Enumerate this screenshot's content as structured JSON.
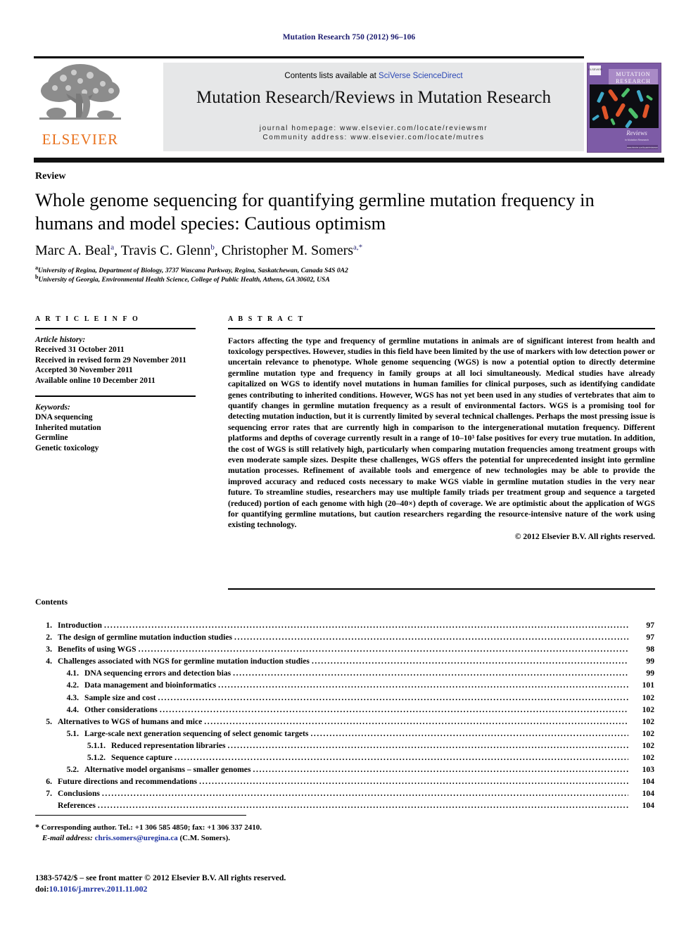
{
  "running_head": "Mutation Research 750 (2012) 96–106",
  "masthead": {
    "contents_prefix": "Contents lists available at ",
    "sciencedirect_link": "SciVerse ScienceDirect",
    "journal_title": "Mutation Research/Reviews in Mutation Research",
    "homepage": "journal homepage: www.elsevier.com/locate/reviewsmr",
    "community": "Community address: www.elsevier.com/locate/mutres",
    "publisher_wordmark": "ELSEVIER",
    "publisher_logo_icon": "elsevier-tree-icon",
    "cover": {
      "line1": "MUTATION",
      "line2": "RESEARCH",
      "line3": "Reviews",
      "line4": "in Mutation Research",
      "footer": "www.elsevier.com/locate/reviewsmr"
    },
    "accent_orange": "#E9711C",
    "link_blue": "#2b47b5",
    "band_grey": "#e6e7e8",
    "cover_purple": "#7d5ba6"
  },
  "article": {
    "doctype": "Review",
    "title": "Whole genome sequencing for quantifying germline mutation frequency in humans and model species: Cautious optimism",
    "authors": [
      {
        "name": "Marc A. Beal",
        "sup": "a"
      },
      {
        "name": "Travis C. Glenn",
        "sup": "b"
      },
      {
        "name": "Christopher M. Somers",
        "sup": "a,*"
      }
    ],
    "affiliations": [
      {
        "mark": "a",
        "text": "University of Regina, Department of Biology, 3737 Wascana Parkway, Regina, Saskatchewan, Canada S4S 0A2"
      },
      {
        "mark": "b",
        "text": "University of Georgia, Environmental Health Science, College of Public Health, Athens, GA 30602, USA"
      }
    ]
  },
  "article_info": {
    "heading": "A R T I C L E  I N F O",
    "history_label": "Article history:",
    "history": [
      "Received 31 October 2011",
      "Received in revised form 29 November 2011",
      "Accepted 30 November 2011",
      "Available online 10 December 2011"
    ],
    "keywords_label": "Keywords:",
    "keywords": [
      "DNA sequencing",
      "Inherited mutation",
      "Germline",
      "Genetic toxicology"
    ]
  },
  "abstract": {
    "heading": "A B S T R A C T",
    "text": "Factors affecting the type and frequency of germline mutations in animals are of significant interest from health and toxicology perspectives. However, studies in this field have been limited by the use of markers with low detection power or uncertain relevance to phenotype. Whole genome sequencing (WGS) is now a potential option to directly determine germline mutation type and frequency in family groups at all loci simultaneously. Medical studies have already capitalized on WGS to identify novel mutations in human families for clinical purposes, such as identifying candidate genes contributing to inherited conditions. However, WGS has not yet been used in any studies of vertebrates that aim to quantify changes in germline mutation frequency as a result of environmental factors. WGS is a promising tool for detecting mutation induction, but it is currently limited by several technical challenges. Perhaps the most pressing issue is sequencing error rates that are currently high in comparison to the intergenerational mutation frequency. Different platforms and depths of coverage currently result in a range of 10–10³ false positives for every true mutation. In addition, the cost of WGS is still relatively high, particularly when comparing mutation frequencies among treatment groups with even moderate sample sizes. Despite these challenges, WGS offers the potential for unprecedented insight into germline mutation processes. Refinement of available tools and emergence of new technologies may be able to provide the improved accuracy and reduced costs necessary to make WGS viable in germline mutation studies in the very near future. To streamline studies, researchers may use multiple family triads per treatment group and sequence a targeted (reduced) portion of each genome with high (20–40×) depth of coverage. We are optimistic about the application of WGS for quantifying germline mutations, but caution researchers regarding the resource-intensive nature of the work using existing technology.",
    "copyright": "© 2012 Elsevier B.V. All rights reserved."
  },
  "contents": {
    "heading": "Contents",
    "entries": [
      {
        "level": 1,
        "num": "1.",
        "label": "Introduction",
        "page": "97"
      },
      {
        "level": 1,
        "num": "2.",
        "label": "The design of germline mutation induction studies",
        "page": "97"
      },
      {
        "level": 1,
        "num": "3.",
        "label": "Benefits of using WGS",
        "page": "98"
      },
      {
        "level": 1,
        "num": "4.",
        "label": "Challenges associated with NGS for germline mutation induction studies",
        "page": "99"
      },
      {
        "level": 2,
        "num": "4.1.",
        "label": "DNA sequencing errors and detection bias",
        "page": "99"
      },
      {
        "level": 2,
        "num": "4.2.",
        "label": "Data management and bioinformatics",
        "page": "101"
      },
      {
        "level": 2,
        "num": "4.3.",
        "label": "Sample size and cost",
        "page": "102"
      },
      {
        "level": 2,
        "num": "4.4.",
        "label": "Other considerations",
        "page": "102"
      },
      {
        "level": 1,
        "num": "5.",
        "label": "Alternatives to WGS of humans and mice",
        "page": "102"
      },
      {
        "level": 2,
        "num": "5.1.",
        "label": "Large-scale next generation sequencing of select genomic targets",
        "page": "102"
      },
      {
        "level": 3,
        "num": "5.1.1.",
        "label": "Reduced representation libraries",
        "page": "102"
      },
      {
        "level": 3,
        "num": "5.1.2.",
        "label": "Sequence capture",
        "page": "102"
      },
      {
        "level": 2,
        "num": "5.2.",
        "label": "Alternative model organisms – smaller genomes",
        "page": "103"
      },
      {
        "level": 1,
        "num": "6.",
        "label": "Future directions and recommendations",
        "page": "104"
      },
      {
        "level": 1,
        "num": "7.",
        "label": "Conclusions",
        "page": "104"
      },
      {
        "level": 0,
        "num": "",
        "label": "References",
        "page": "104"
      }
    ]
  },
  "footnotes": {
    "corresponding_marker": "*",
    "corresponding_text": "Corresponding author. Tel.: +1 306 585 4850; fax: +1 306 337 2410.",
    "email_label": "E-mail address:",
    "email": "chris.somers@uregina.ca",
    "email_owner": "(C.M. Somers).",
    "imprint": "1383-5742/$ – see front matter © 2012 Elsevier B.V. All rights reserved.",
    "doi_label": "doi:",
    "doi": "10.1016/j.mrrev.2011.11.002"
  }
}
